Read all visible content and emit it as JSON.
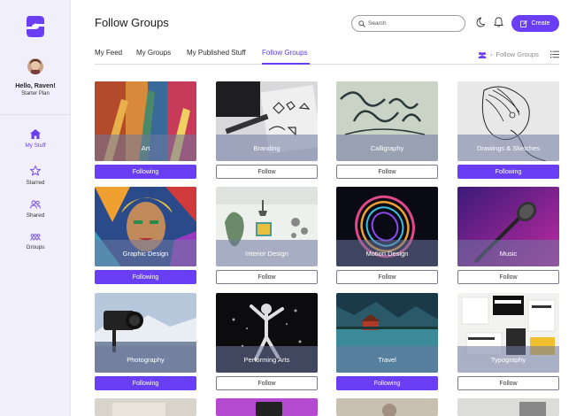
{
  "brand": {
    "accent": "#6a3ef4",
    "logo": "s-logo-icon"
  },
  "user": {
    "greeting": "Hello, Raven!",
    "plan": "Starter Plan"
  },
  "sidebar": {
    "items": [
      {
        "label": "My Stuff",
        "icon": "home-icon",
        "active": true
      },
      {
        "label": "Starred",
        "icon": "star-icon",
        "active": false
      },
      {
        "label": "Shared",
        "icon": "people-icon",
        "active": false
      },
      {
        "label": "Groups",
        "icon": "groups-icon",
        "active": false
      }
    ]
  },
  "header": {
    "title": "Follow Groups",
    "search_placeholder": "Search",
    "create_label": "Create"
  },
  "tabs": [
    {
      "label": "My Feed",
      "active": false
    },
    {
      "label": "My Groups",
      "active": false
    },
    {
      "label": "My Published Stuff",
      "active": false
    },
    {
      "label": "Follow Groups",
      "active": true
    }
  ],
  "breadcrumb": {
    "label": "Follow Groups"
  },
  "groups": [
    {
      "name": "Art",
      "status": "Following"
    },
    {
      "name": "Branding",
      "status": "Follow"
    },
    {
      "name": "Calligraphy",
      "status": "Follow"
    },
    {
      "name": "Drawings & Sketches",
      "status": "Following"
    },
    {
      "name": "Graphic Design",
      "status": "Following"
    },
    {
      "name": "Interior Design",
      "status": "Follow"
    },
    {
      "name": "Motion Design",
      "status": "Follow"
    },
    {
      "name": "Music",
      "status": "Follow"
    },
    {
      "name": "Photography",
      "status": "Following"
    },
    {
      "name": "Performing Arts",
      "status": "Follow"
    },
    {
      "name": "Travel",
      "status": "Following"
    },
    {
      "name": "Typography",
      "status": "Follow"
    }
  ]
}
